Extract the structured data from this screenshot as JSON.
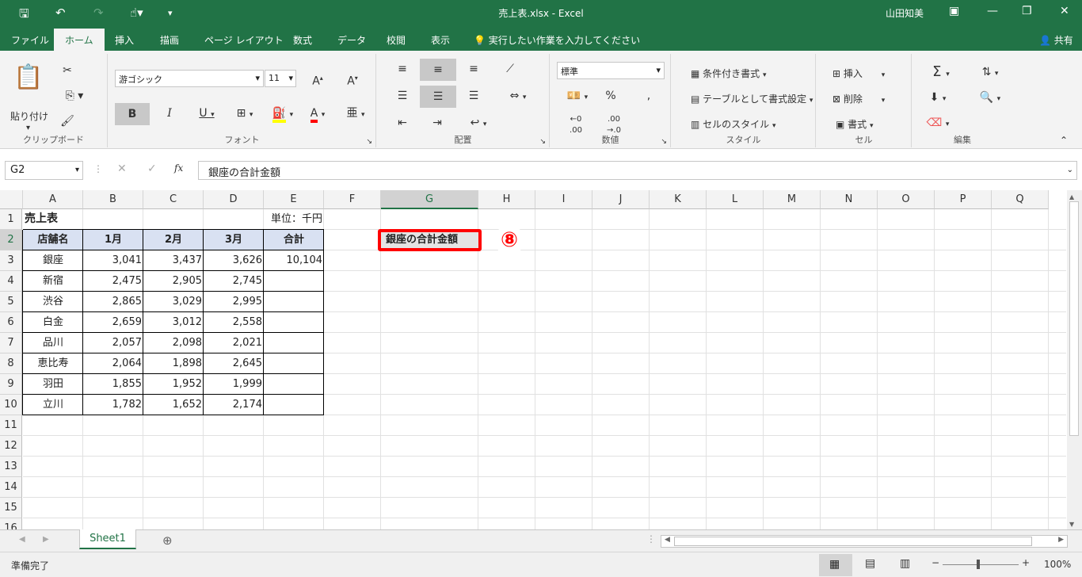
{
  "window": {
    "title": "売上表.xlsx  -  Excel",
    "user": "山田知美",
    "share": "共有"
  },
  "tabs": [
    "ファイル",
    "ホーム",
    "挿入",
    "描画",
    "ページ レイアウト",
    "数式",
    "データ",
    "校閲",
    "表示"
  ],
  "tellme": "実行したい作業を入力してください",
  "ribbon": {
    "clipboard": {
      "label": "クリップボード",
      "paste": "貼り付け"
    },
    "font": {
      "label": "フォント",
      "name": "游ゴシック",
      "size": "11"
    },
    "align": {
      "label": "配置"
    },
    "number": {
      "label": "数値",
      "format": "標準"
    },
    "styles": {
      "label": "スタイル",
      "cond": "条件付き書式",
      "table": "テーブルとして書式設定",
      "cell": "セルのスタイル"
    },
    "cells": {
      "label": "セル",
      "insert": "挿入",
      "delete": "削除",
      "format": "書式"
    },
    "edit": {
      "label": "編集"
    }
  },
  "formula": {
    "namebox": "G2",
    "value": "銀座の合計金額"
  },
  "columns": [
    "A",
    "B",
    "C",
    "D",
    "E",
    "F",
    "G",
    "H",
    "I",
    "J",
    "K",
    "L",
    "M",
    "N",
    "O",
    "P",
    "Q"
  ],
  "rows": [
    "1",
    "2",
    "3",
    "4",
    "5",
    "6",
    "7",
    "8",
    "9",
    "10",
    "11",
    "12",
    "13",
    "14",
    "15",
    "16"
  ],
  "sheet": {
    "title": "売上表",
    "unit": "単位：千円",
    "headers": [
      "店舗名",
      "1月",
      "2月",
      "3月",
      "合計"
    ],
    "data": [
      [
        "銀座",
        "3,041",
        "3,437",
        "3,626",
        "10,104"
      ],
      [
        "新宿",
        "2,475",
        "2,905",
        "2,745",
        ""
      ],
      [
        "渋谷",
        "2,865",
        "3,029",
        "2,995",
        ""
      ],
      [
        "白金",
        "2,659",
        "3,012",
        "2,558",
        ""
      ],
      [
        "品川",
        "2,057",
        "2,098",
        "2,021",
        ""
      ],
      [
        "恵比寿",
        "2,064",
        "1,898",
        "2,645",
        ""
      ],
      [
        "羽田",
        "1,855",
        "1,952",
        "1,999",
        ""
      ],
      [
        "立川",
        "1,782",
        "1,652",
        "2,174",
        ""
      ]
    ],
    "g2": "銀座の合計金額",
    "callout": "⑧"
  },
  "sheettab": "Sheet1",
  "status": {
    "ready": "準備完了",
    "zoom": "100%"
  },
  "colors": {
    "excel_green": "#217346",
    "header_fill": "#d9e1f2",
    "callout_red": "#ff0000"
  }
}
